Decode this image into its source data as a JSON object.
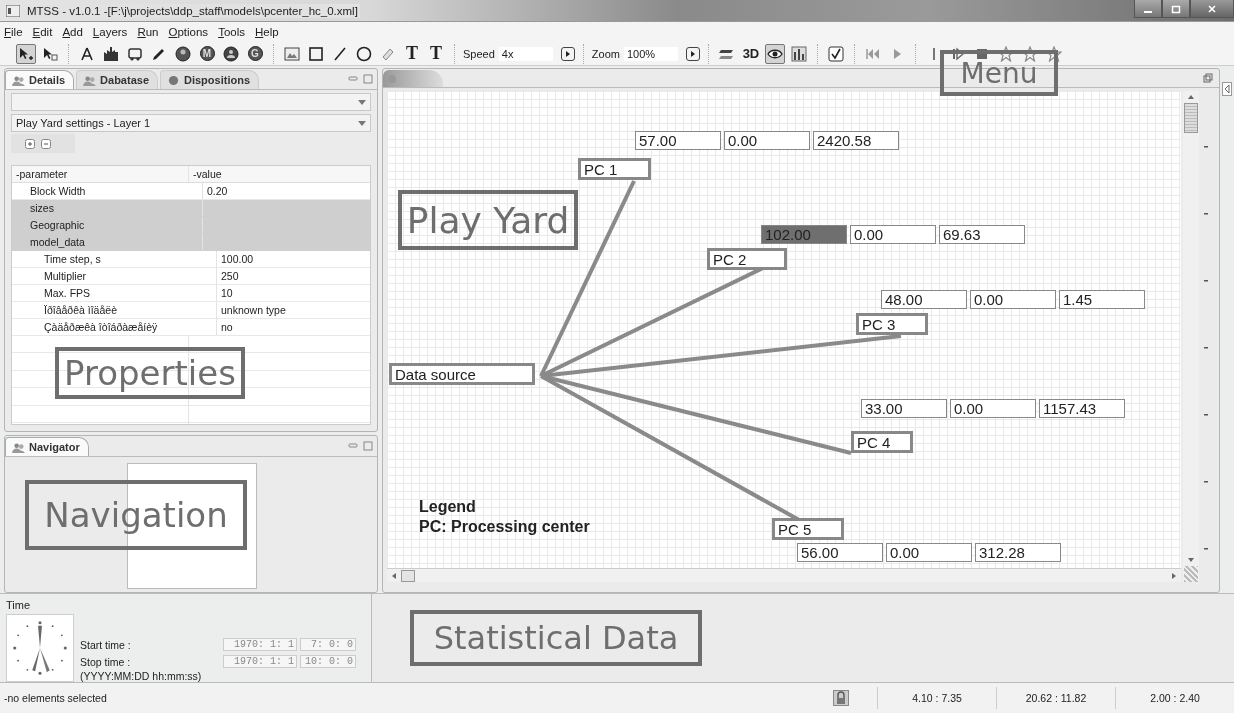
{
  "window": {
    "title": "MTSS - v1.0.1  -[F:\\j\\projects\\ddp_staff\\models\\pcenter_hc_0.xml]"
  },
  "menu": [
    "File",
    "Edit",
    "Add",
    "Layers",
    "Run",
    "Options",
    "Tools",
    "Help"
  ],
  "toolbar": {
    "groups": [
      {
        "items": [
          {
            "kind": "icon",
            "selected": true
          },
          {
            "kind": "icon",
            "selected": false
          }
        ]
      },
      {
        "items": [
          {
            "kind": "icon",
            "selected": false
          },
          {
            "kind": "icon",
            "selected": false
          },
          {
            "kind": "icon",
            "selected": false
          },
          {
            "kind": "icon",
            "selected": false
          },
          {
            "kind": "icon",
            "selected": false
          },
          {
            "kind": "letter",
            "label": "M",
            "selected": false
          },
          {
            "kind": "icon",
            "selected": false
          },
          {
            "kind": "letter",
            "label": "G",
            "selected": false
          }
        ]
      },
      {
        "items": [
          {
            "kind": "icon",
            "selected": false
          },
          {
            "kind": "icon",
            "selected": false
          },
          {
            "kind": "icon",
            "selected": false
          },
          {
            "kind": "icon",
            "selected": false
          },
          {
            "kind": "icon",
            "selected": false
          },
          {
            "kind": "text",
            "label": "T",
            "selected": false
          },
          {
            "kind": "text",
            "label": "T",
            "selected": false
          }
        ]
      },
      {
        "items": [
          {
            "kind": "field",
            "label": "Speed",
            "value": "4x"
          }
        ]
      },
      {
        "items": [
          {
            "kind": "field",
            "label": "Zoom",
            "value": "100%"
          }
        ]
      },
      {
        "items": [
          {
            "kind": "icon",
            "selected": false
          },
          {
            "kind": "text",
            "label": "3D",
            "selected": false
          },
          {
            "kind": "icon",
            "selected": true
          },
          {
            "kind": "icon",
            "selected": false
          }
        ]
      },
      {
        "items": [
          {
            "kind": "check",
            "checked": true
          }
        ]
      },
      {
        "items": [
          {
            "kind": "icon",
            "selected": false
          },
          {
            "kind": "icon",
            "selected": false
          }
        ]
      },
      {
        "items": [
          {
            "kind": "icon",
            "selected": false
          },
          {
            "kind": "icon",
            "selected": false
          },
          {
            "kind": "icon",
            "selected": false
          },
          {
            "kind": "icon",
            "selected": false
          },
          {
            "kind": "icon",
            "selected": false
          },
          {
            "kind": "icon",
            "selected": false
          }
        ]
      }
    ]
  },
  "details_panel": {
    "tabs": [
      {
        "label": "Details",
        "selected": true
      },
      {
        "label": "Dabatase",
        "selected": false
      },
      {
        "label": "Dispositions",
        "selected": false
      }
    ],
    "layer_select": {
      "value": "Play Yard settings - Layer 1"
    },
    "table": {
      "columns": [
        "-parameter",
        "-value"
      ],
      "rows": [
        {
          "kind": "property",
          "parameter": "Block Width",
          "value": "0.20"
        },
        {
          "kind": "category",
          "parameter": "sizes"
        },
        {
          "kind": "category",
          "parameter": "Geographic"
        },
        {
          "kind": "category",
          "parameter": "model_data",
          "children": [
            {
              "kind": "property",
              "parameter": "Time step, s",
              "value": "100.00"
            },
            {
              "kind": "property",
              "parameter": "Multiplier",
              "value": "250"
            },
            {
              "kind": "property",
              "parameter": "Max. FPS",
              "value": "10"
            },
            {
              "kind": "property",
              "parameter": "Ïðîâåðêà ìîäåëè",
              "value": "unknown type"
            },
            {
              "kind": "property",
              "parameter": "Çàäåðæêà îòîáðàæåíèÿ",
              "value": "no"
            }
          ]
        }
      ]
    }
  },
  "navigator": {
    "tab": "Navigator"
  },
  "play_yard": {
    "source": {
      "label": "Data source"
    },
    "centers": [
      {
        "label": "PC 1",
        "values": [
          {
            "text": "57.00",
            "highlighted": false
          },
          {
            "text": "0.00",
            "highlighted": false
          },
          {
            "text": "2420.58",
            "highlighted": false
          }
        ]
      },
      {
        "label": "PC 2",
        "values": [
          {
            "text": "102.00",
            "highlighted": true
          },
          {
            "text": "0.00",
            "highlighted": false
          },
          {
            "text": "69.63",
            "highlighted": false
          }
        ]
      },
      {
        "label": "PC 3",
        "values": [
          {
            "text": "48.00",
            "highlighted": false
          },
          {
            "text": "0.00",
            "highlighted": false
          },
          {
            "text": "1.45",
            "highlighted": false
          }
        ]
      },
      {
        "label": "PC 4",
        "values": [
          {
            "text": "33.00",
            "highlighted": false
          },
          {
            "text": "0.00",
            "highlighted": false
          },
          {
            "text": "1157.43",
            "highlighted": false
          }
        ]
      },
      {
        "label": "PC 5",
        "values": [
          {
            "text": "56.00",
            "highlighted": false
          },
          {
            "text": "0.00",
            "highlighted": false
          },
          {
            "text": "312.28",
            "highlighted": false
          }
        ]
      }
    ],
    "legend": {
      "title": "Legend",
      "text": "PC: Processing center"
    }
  },
  "time_panel": {
    "title": "Time",
    "start_label": "Start time :",
    "start_date": "1970: 1: 1",
    "start_time": "7: 0: 0",
    "stop_label": "Stop time :",
    "stop_date": "1970: 1: 1",
    "stop_time": "10: 0: 0",
    "format": "(YYYY:MM:DD hh:mm:ss)"
  },
  "annotations": [
    "Menu",
    "Play Yard",
    "Properties",
    "Navigation",
    "Statistical Data"
  ],
  "status_bar": {
    "message": "-no elements selected",
    "cells": [
      "4.10 : 7.35",
      "20.62 : 11.82",
      "2.00 : 2.40"
    ]
  }
}
